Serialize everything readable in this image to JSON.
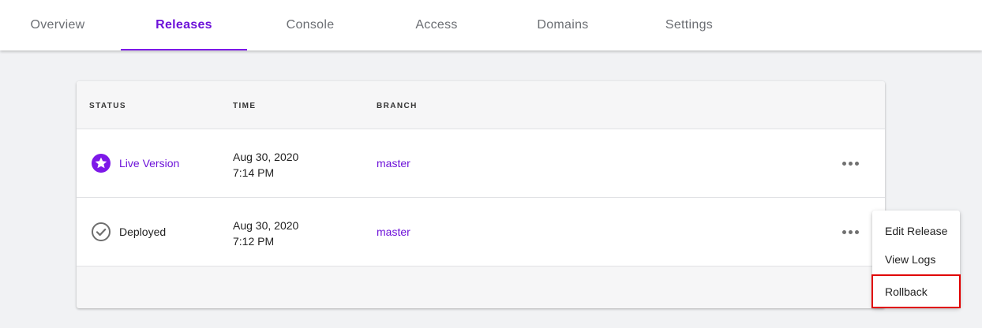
{
  "tabs": [
    {
      "label": "Overview",
      "active": false
    },
    {
      "label": "Releases",
      "active": true
    },
    {
      "label": "Console",
      "active": false
    },
    {
      "label": "Access",
      "active": false
    },
    {
      "label": "Domains",
      "active": false
    },
    {
      "label": "Settings",
      "active": false
    }
  ],
  "table": {
    "columns": {
      "status": "STATUS",
      "time": "TIME",
      "branch": "BRANCH"
    },
    "rows": [
      {
        "status": "Live Version",
        "status_icon": "star-icon",
        "date": "Aug 30, 2020",
        "clock": "7:14 PM",
        "branch": "master"
      },
      {
        "status": "Deployed",
        "status_icon": "check-circle-icon",
        "date": "Aug 30, 2020",
        "clock": "7:12 PM",
        "branch": "master"
      }
    ]
  },
  "menu": {
    "items": [
      "Edit Release",
      "View Logs",
      "Rollback"
    ],
    "highlighted": "Rollback"
  },
  "colors": {
    "accent": "#6d12d9",
    "highlight_border": "#e00000",
    "muted_text": "#6b6e73"
  }
}
